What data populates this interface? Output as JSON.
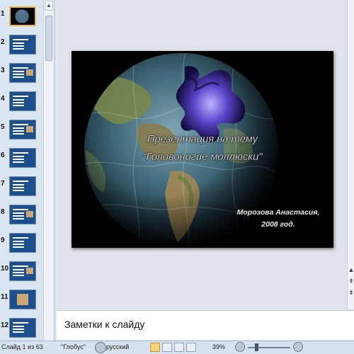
{
  "thumbnails": [
    {
      "number": "1",
      "selected": true,
      "style": "globe"
    },
    {
      "number": "2",
      "selected": false,
      "style": "text"
    },
    {
      "number": "3",
      "selected": false,
      "style": "text-pic"
    },
    {
      "number": "4",
      "selected": false,
      "style": "text"
    },
    {
      "number": "5",
      "selected": false,
      "style": "text-pic"
    },
    {
      "number": "6",
      "selected": false,
      "style": "text"
    },
    {
      "number": "7",
      "selected": false,
      "style": "text"
    },
    {
      "number": "8",
      "selected": false,
      "style": "text-pic"
    },
    {
      "number": "9",
      "selected": false,
      "style": "text"
    },
    {
      "number": "10",
      "selected": false,
      "style": "text-pic"
    },
    {
      "number": "11",
      "selected": false,
      "style": "pic"
    },
    {
      "number": "12",
      "selected": false,
      "style": "text"
    }
  ],
  "slide": {
    "title_line1": "Презентация на тему",
    "title_line2": "\"Головоногие моллюски\"",
    "author_line1": "Морозова Анастасия,",
    "author_line2": "2008 год."
  },
  "notes": {
    "placeholder": "Заметки к слайду"
  },
  "status": {
    "slide_info": "Слайд 1 из 63",
    "theme": "\"Глобус\"",
    "language": "русский",
    "zoom": "39%"
  },
  "colors": {
    "thumb_blue": "#1d4f8c",
    "selected_border": "#f1b73e",
    "pane_bg": "#dbe5f2"
  }
}
